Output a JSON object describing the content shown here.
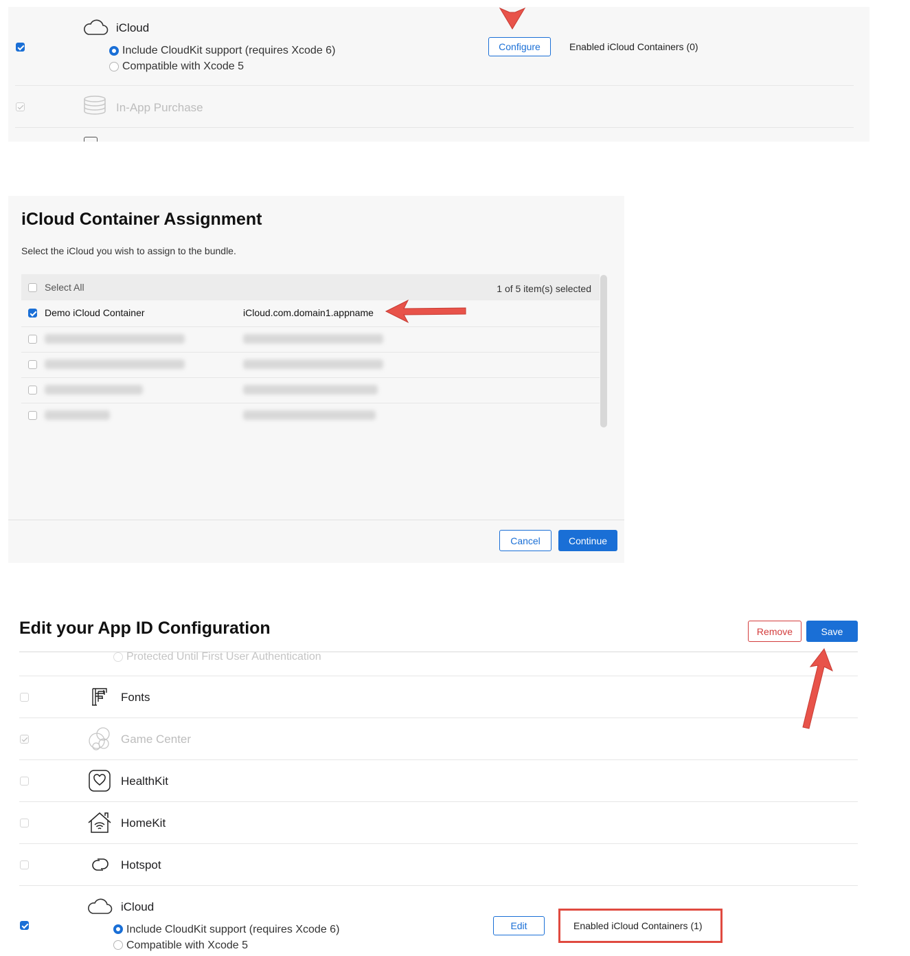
{
  "top_panel": {
    "icloud_label": "iCloud",
    "radio_cloudkit": "Include CloudKit support (requires Xcode 6)",
    "radio_xcode5": "Compatible with Xcode 5",
    "configure_button": "Configure",
    "enabled_containers": "Enabled iCloud Containers (0)",
    "iap_label": "In-App Purchase"
  },
  "dialog": {
    "title": "iCloud Container Assignment",
    "subtitle": "Select the iCloud you wish to assign to the bundle.",
    "select_all": "Select All",
    "selection_count": "1 of 5 item(s) selected",
    "rows": [
      {
        "name": "Demo iCloud Container",
        "id": "iCloud.com.domain1.appname",
        "checked": true,
        "blurred": false
      },
      {
        "checked": false,
        "blurred": true
      },
      {
        "checked": false,
        "blurred": true
      },
      {
        "checked": false,
        "blurred": true
      },
      {
        "checked": false,
        "blurred": true
      }
    ],
    "cancel_button": "Cancel",
    "continue_button": "Continue"
  },
  "edit_panel": {
    "title": "Edit your App ID Configuration",
    "remove_button": "Remove",
    "save_button": "Save",
    "protected_option": "Protected Until First User Authentication",
    "capabilities": [
      {
        "label": "Fonts",
        "icon": "fonts-icon",
        "state": "unchecked"
      },
      {
        "label": "Game Center",
        "icon": "game-center-icon",
        "state": "disabled-checked"
      },
      {
        "label": "HealthKit",
        "icon": "healthkit-icon",
        "state": "unchecked"
      },
      {
        "label": "HomeKit",
        "icon": "homekit-icon",
        "state": "unchecked"
      },
      {
        "label": "Hotspot",
        "icon": "hotspot-icon",
        "state": "unchecked"
      }
    ],
    "icloud_label": "iCloud",
    "radio_cloudkit": "Include CloudKit support (requires Xcode 6)",
    "radio_xcode5": "Compatible with Xcode 5",
    "edit_button": "Edit",
    "enabled_containers": "Enabled iCloud Containers (1)"
  },
  "colors": {
    "accent": "#1a6fd6",
    "danger": "#d33c3c",
    "annotation_arrow": "#e8534a",
    "highlight_box": "#e04a40"
  }
}
